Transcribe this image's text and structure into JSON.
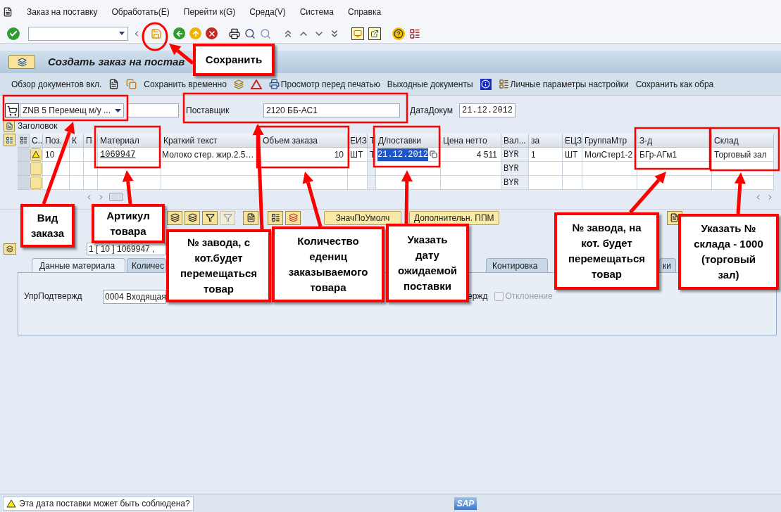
{
  "menu_bar": {
    "items": [
      "Заказ на поставку",
      "Обработать(E)",
      "Перейти к(G)",
      "Среда(V)",
      "Система",
      "Справка"
    ]
  },
  "title": "Создать заказ на постав",
  "app_toolbar": [
    "Обзор документов вкл.",
    "Сохранить временно",
    "Просмотр перед печатью",
    "Выходные документы",
    "Личные параметры настройки",
    "Сохранить как обра"
  ],
  "header": {
    "order_type": "ZNB 5 Перемещ м/у ...",
    "vendor_label": "Поставщик",
    "vendor": "2120 ББ-АС1",
    "doc_date_label": "ДатаДокум",
    "doc_date": "21.12.2012"
  },
  "header_toggle": "Заголовок",
  "table": {
    "columns": [
      "С..",
      "Поз.",
      "К",
      "П",
      "Материал",
      "Краткий текст",
      "Объем заказа",
      "ЕИЗ",
      "Т",
      "Д/поставки",
      "Цена нетто",
      "Вал...",
      "за",
      "ЕЦЗ",
      "ГруппаМтр",
      "З-д",
      "Склад"
    ],
    "rows": [
      {
        "warning": true,
        "delivery_date_highlighted": true,
        "cells": [
          "",
          "10",
          "",
          "",
          "1069947",
          "Молоко стер. жир.2.5…",
          "10",
          "ШТ",
          "Т",
          "21.12.2012",
          "4 511",
          "BYR",
          "1",
          "ШТ",
          "МолСтер1-2",
          "БГр-АГм1",
          "Торговый зал"
        ]
      },
      {
        "warning": false,
        "cells": [
          "",
          "",
          "",
          "",
          "",
          "",
          "",
          "",
          "",
          "",
          "",
          "BYR",
          "",
          "",
          "",
          "",
          ""
        ]
      },
      {
        "warning": false,
        "cells": [
          "",
          "",
          "",
          "",
          "",
          "",
          "",
          "",
          "",
          "",
          "",
          "BYR",
          "",
          "",
          "",
          "",
          ""
        ]
      }
    ]
  },
  "item_toolbar": [
    "ЗначПоУмолч",
    "Дополнительн. ППМ"
  ],
  "item_selector": "1 [ 10 ] 1069947 ,",
  "tabs": [
    {
      "label": "Данные материала",
      "selected": true
    },
    {
      "label": "Количес",
      "selected": false
    },
    {
      "label": "Контировка",
      "selected": false
    },
    {
      "label": "ки",
      "selected": false
    }
  ],
  "tab_fields": {
    "confirmation_label": "УпрПодтвержд",
    "confirmation_value": "0004 Входящая",
    "cut_label": "ержд",
    "deviation": {
      "label": "Отклонение",
      "checked": false,
      "disabled": true
    }
  },
  "status_bar": {
    "kind": "warning",
    "message": "Эта дата поставки может быть соблюдена?",
    "logo": "SAP"
  },
  "callouts": [
    {
      "text": "Сохранить"
    },
    {
      "text": "Вид\nзаказа"
    },
    {
      "text": "Артикул\nтовара"
    },
    {
      "text": "№ завода, с\nкот.будет\nперемещаться\nтовар"
    },
    {
      "text": "Количество\nедениц\nзаказываемого\nтовара"
    },
    {
      "text": "Указать\nдату\nожидаемой\nпоставки"
    },
    {
      "text": "№ завода, на\nкот. будет\nперемещаться\nтовар"
    },
    {
      "text": "Указать №\nсклада - 1000\n(торговый\nзал)"
    }
  ]
}
